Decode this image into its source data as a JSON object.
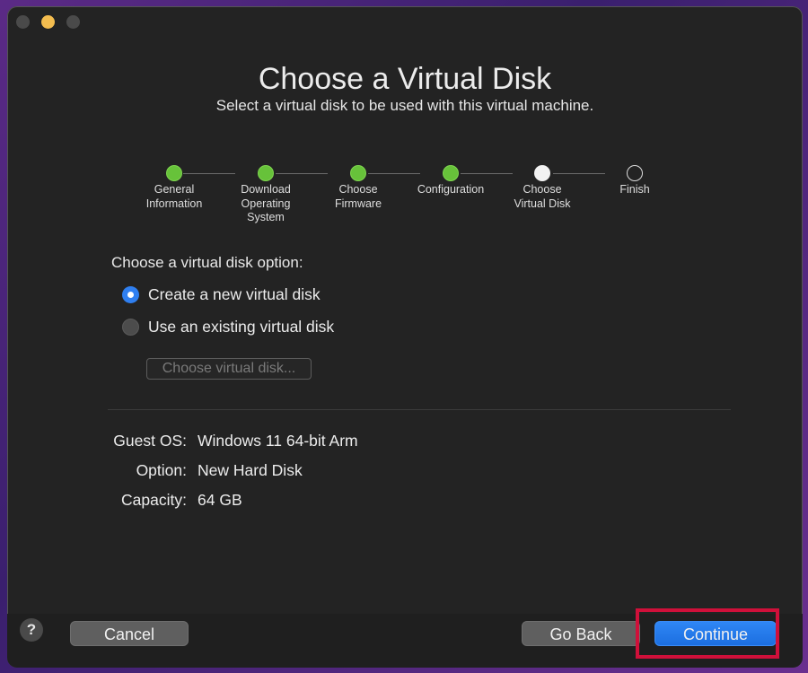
{
  "window": {
    "controls": [
      "close",
      "minimize",
      "zoom"
    ]
  },
  "header": {
    "title": "Choose a Virtual Disk",
    "subtitle": "Select a virtual disk to be used with this virtual machine."
  },
  "steps": [
    {
      "label": "General\nInformation",
      "state": "done"
    },
    {
      "label": "Download\nOperating\nSystem",
      "state": "done"
    },
    {
      "label": "Choose\nFirmware",
      "state": "done"
    },
    {
      "label": "Configuration",
      "state": "done"
    },
    {
      "label": "Choose\nVirtual Disk",
      "state": "current"
    },
    {
      "label": "Finish",
      "state": "todo"
    }
  ],
  "disk_option": {
    "label": "Choose a virtual disk option:",
    "options": [
      {
        "label": "Create a new virtual disk",
        "selected": true
      },
      {
        "label": "Use an existing virtual disk",
        "selected": false
      }
    ],
    "choose_button": "Choose virtual disk..."
  },
  "summary": {
    "guest_os": {
      "key": "Guest OS:",
      "value": "Windows 11 64-bit Arm"
    },
    "option": {
      "key": "Option:",
      "value": "New Hard Disk"
    },
    "capacity": {
      "key": "Capacity:",
      "value": "64 GB"
    }
  },
  "footer": {
    "help": "?",
    "cancel": "Cancel",
    "go_back": "Go Back",
    "continue": "Continue"
  },
  "colors": {
    "step_done": "#67c23a",
    "accent": "#2f7ff0",
    "highlight": "#d0103a"
  }
}
